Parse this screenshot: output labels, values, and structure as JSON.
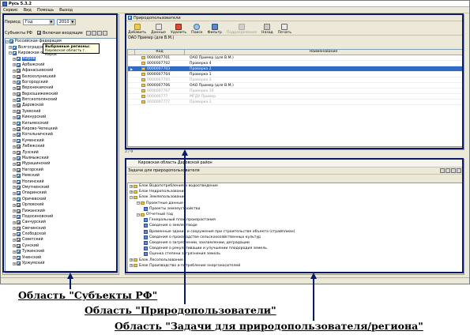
{
  "window": {
    "title": "Русь 5.3.2"
  },
  "menu": [
    "Сервис",
    "Вид",
    "Помощь",
    "Выход"
  ],
  "left_panel": {
    "period_label": "Период",
    "period_value": "Год",
    "year_value": "2010",
    "subjects_label": "Субъекты РФ",
    "include_nested_label": "Включая входящие",
    "tree_root": "Российская федерация",
    "tree_level1": [
      "Волгоградская область",
      "Кировская область"
    ],
    "tree_selected": "Киров",
    "tree_items": [
      "Арбажский",
      "Афанасьевский",
      "Белохолуницкий",
      "Богородский",
      "Верхнекамский",
      "Верхошижемский",
      "Вятскополянский",
      "Даровской",
      "Зуевский",
      "Кикнурский",
      "Кильмезский",
      "Кирово-Чепецкий",
      "Котельничский",
      "Куменский",
      "Лебяжский",
      "Лузский",
      "Малмыжский",
      "Мурашинский",
      "Нагорский",
      "Немский",
      "Нолинский",
      "Омутнинский",
      "Опаринский",
      "Оричевский",
      "Орловский",
      "Пижанский",
      "Подосиновский",
      "Санчурский",
      "Свечинский",
      "Слободской",
      "Советский",
      "Сунский",
      "Тужинский",
      "Унинский",
      "Уржумский"
    ],
    "tooltip_title": "Выбранные регионы:",
    "tooltip_text": "Кировская область г. Киров"
  },
  "users_panel": {
    "header": "Природопользователи",
    "toolbar": [
      "Добавить",
      "Данные",
      "Удалить",
      "Поиск",
      "Фильтр",
      "Подразделения",
      "Назад",
      "Печать"
    ],
    "org_label": "ОАО Пример (для В.М.)",
    "columns": {
      "code": "Код",
      "name": "Наименование"
    },
    "rows": [
      {
        "code": "0000007701",
        "name": "ОАО Пример (для В.М.)"
      },
      {
        "code": "0000007702",
        "name": "Проверка 4"
      },
      {
        "code": "0000007703",
        "name": "Проверка 2"
      },
      {
        "code": "0000007704",
        "name": "Проверка 1"
      },
      {
        "code": "0000007705",
        "name": "Проверка 3"
      },
      {
        "code": "0000007706",
        "name": "ОАО Пример (для В.М.)"
      },
      {
        "code": "0000007707",
        "name": "Проверка 10"
      },
      {
        "code": "000000777",
        "name": "МГДУ Пример"
      },
      {
        "code": "0000007777",
        "name": "Проверка 1"
      }
    ],
    "status": "2 / 9"
  },
  "tasks_panel": {
    "region_text": "Кировская область Даровской район",
    "header": "Задачи для природопользователя",
    "tree": [
      {
        "level": 0,
        "type": "folder",
        "text": "Блок Водопотребления и водоотведение"
      },
      {
        "level": 0,
        "type": "folder",
        "text": "Блок Недропользование"
      },
      {
        "level": 0,
        "type": "folder",
        "text": "Блок Землепользование"
      },
      {
        "level": 1,
        "type": "folder",
        "text": "Проектные данные"
      },
      {
        "level": 2,
        "type": "doc",
        "text": "Проекты землеустройства"
      },
      {
        "level": 1,
        "type": "folder",
        "text": "Отчетный год"
      },
      {
        "level": 2,
        "type": "doc",
        "text": "Генеральный план произрастания"
      },
      {
        "level": 2,
        "type": "doc",
        "text": "Сведения о землеотводе"
      },
      {
        "level": 2,
        "type": "doc",
        "text": "Временные здания и сооружения при строительстве объекта (страйплиан)"
      },
      {
        "level": 2,
        "type": "doc",
        "text": "Сведения о производстве сельскохозяйственных культур"
      },
      {
        "level": 2,
        "type": "doc",
        "text": "Сведения о загрязнении, захламлении, деградации"
      },
      {
        "level": 2,
        "type": "doc",
        "text": "Сведения о рекультивации и улучшении плодородия земель"
      },
      {
        "level": 2,
        "type": "doc",
        "text": "Оценка степени загрязнения земель"
      },
      {
        "level": 0,
        "type": "folder",
        "text": "Блок Лесопользование"
      },
      {
        "level": 0,
        "type": "folder",
        "text": "Блок Производство и потребление энергоносителей"
      }
    ]
  },
  "captions": {
    "subjects": "Область \"Субъекты РФ\"",
    "users": "Область \"Природопользователи\"",
    "tasks": "Область \"Задачи для природопользователя/региона\""
  },
  "colors": {
    "selection": "#316ac5",
    "callout": "#0a1a6a",
    "window_bg": "#ece9d8"
  }
}
